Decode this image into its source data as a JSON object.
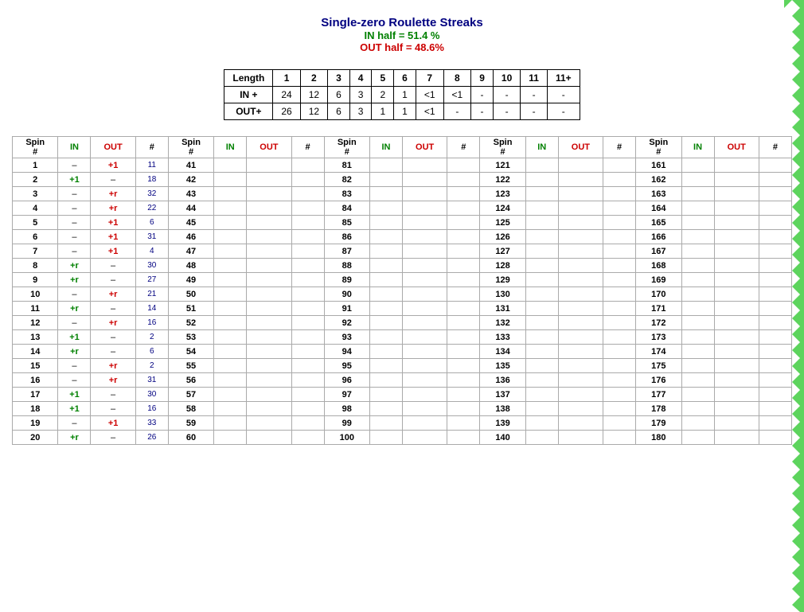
{
  "header": {
    "title": "Single-zero Roulette Streaks",
    "in_half": "IN half = 51.4 %",
    "out_half": "OUT half = 48.6%"
  },
  "summary": {
    "headers": [
      "Length",
      "1",
      "2",
      "3",
      "4",
      "5",
      "6",
      "7",
      "8",
      "9",
      "10",
      "11",
      "11+"
    ],
    "rows": [
      {
        "label": "IN +",
        "values": [
          "24",
          "12",
          "6",
          "3",
          "2",
          "1",
          "<1",
          "<1",
          "-",
          "-",
          "-",
          "-"
        ]
      },
      {
        "label": "OUT+",
        "values": [
          "26",
          "12",
          "6",
          "3",
          "1",
          "1",
          "<1",
          "-",
          "-",
          "-",
          "-",
          "-"
        ]
      }
    ]
  },
  "spin_table": {
    "column_headers": [
      "Spin #",
      "IN",
      "OUT",
      "#"
    ],
    "rows": [
      {
        "spin": "1",
        "in": "–",
        "out": "+1",
        "num": "11",
        "s2": "41",
        "i2": "",
        "o2": "",
        "n2": "",
        "s3": "81",
        "i3": "",
        "o3": "",
        "n3": "",
        "s4": "121",
        "i4": "",
        "o4": "",
        "n4": "",
        "s5": "161",
        "i5": "",
        "o5": "",
        "n5": ""
      },
      {
        "spin": "2",
        "in": "+1",
        "out": "–",
        "num": "18",
        "s2": "42",
        "i2": "",
        "o2": "",
        "n2": "",
        "s3": "82",
        "i3": "",
        "o3": "",
        "n3": "",
        "s4": "122",
        "i4": "",
        "o4": "",
        "n4": "",
        "s5": "162",
        "i5": "",
        "o5": "",
        "n5": ""
      },
      {
        "spin": "3",
        "in": "–",
        "out": "+r",
        "num": "32",
        "s2": "43",
        "i2": "",
        "o2": "",
        "n2": "",
        "s3": "83",
        "i3": "",
        "o3": "",
        "n3": "",
        "s4": "123",
        "i4": "",
        "o4": "",
        "n4": "",
        "s5": "163",
        "i5": "",
        "o5": "",
        "n5": ""
      },
      {
        "spin": "4",
        "in": "–",
        "out": "+r",
        "num": "22",
        "s2": "44",
        "i2": "",
        "o2": "",
        "n2": "",
        "s3": "84",
        "i3": "",
        "o3": "",
        "n3": "",
        "s4": "124",
        "i4": "",
        "o4": "",
        "n4": "",
        "s5": "164",
        "i5": "",
        "o5": "",
        "n5": ""
      },
      {
        "spin": "5",
        "in": "–",
        "out": "+1",
        "num": "6",
        "s2": "45",
        "i2": "",
        "o2": "",
        "n2": "",
        "s3": "85",
        "i3": "",
        "o3": "",
        "n3": "",
        "s4": "125",
        "i4": "",
        "o4": "",
        "n4": "",
        "s5": "165",
        "i5": "",
        "o5": "",
        "n5": ""
      },
      {
        "spin": "6",
        "in": "–",
        "out": "+1",
        "num": "31",
        "s2": "46",
        "i2": "",
        "o2": "",
        "n2": "",
        "s3": "86",
        "i3": "",
        "o3": "",
        "n3": "",
        "s4": "126",
        "i4": "",
        "o4": "",
        "n4": "",
        "s5": "166",
        "i5": "",
        "o5": "",
        "n5": ""
      },
      {
        "spin": "7",
        "in": "–",
        "out": "+1",
        "num": "4",
        "s2": "47",
        "i2": "",
        "o2": "",
        "n2": "",
        "s3": "87",
        "i3": "",
        "o3": "",
        "n3": "",
        "s4": "127",
        "i4": "",
        "o4": "",
        "n4": "",
        "s5": "167",
        "i5": "",
        "o5": "",
        "n5": ""
      },
      {
        "spin": "8",
        "in": "+r",
        "out": "–",
        "num": "30",
        "s2": "48",
        "i2": "",
        "o2": "",
        "n2": "",
        "s3": "88",
        "i3": "",
        "o3": "",
        "n3": "",
        "s4": "128",
        "i4": "",
        "o4": "",
        "n4": "",
        "s5": "168",
        "i5": "",
        "o5": "",
        "n5": ""
      },
      {
        "spin": "9",
        "in": "+r",
        "out": "–",
        "num": "27",
        "s2": "49",
        "i2": "",
        "o2": "",
        "n2": "",
        "s3": "89",
        "i3": "",
        "o3": "",
        "n3": "",
        "s4": "129",
        "i4": "",
        "o4": "",
        "n4": "",
        "s5": "169",
        "i5": "",
        "o5": "",
        "n5": ""
      },
      {
        "spin": "10",
        "in": "–",
        "out": "+r",
        "num": "21",
        "s2": "50",
        "i2": "",
        "o2": "",
        "n2": "",
        "s3": "90",
        "i3": "",
        "o3": "",
        "n3": "",
        "s4": "130",
        "i4": "",
        "o4": "",
        "n4": "",
        "s5": "170",
        "i5": "",
        "o5": "",
        "n5": ""
      },
      {
        "spin": "11",
        "in": "+r",
        "out": "–",
        "num": "14",
        "s2": "51",
        "i2": "",
        "o2": "",
        "n2": "",
        "s3": "91",
        "i3": "",
        "o3": "",
        "n3": "",
        "s4": "131",
        "i4": "",
        "o4": "",
        "n4": "",
        "s5": "171",
        "i5": "",
        "o5": "",
        "n5": ""
      },
      {
        "spin": "12",
        "in": "–",
        "out": "+r",
        "num": "16",
        "s2": "52",
        "i2": "",
        "o2": "",
        "n2": "",
        "s3": "92",
        "i3": "",
        "o3": "",
        "n3": "",
        "s4": "132",
        "i4": "",
        "o4": "",
        "n4": "",
        "s5": "172",
        "i5": "",
        "o5": "",
        "n5": ""
      },
      {
        "spin": "13",
        "in": "+1",
        "out": "–",
        "num": "2",
        "s2": "53",
        "i2": "",
        "o2": "",
        "n2": "",
        "s3": "93",
        "i3": "",
        "o3": "",
        "n3": "",
        "s4": "133",
        "i4": "",
        "o4": "",
        "n4": "",
        "s5": "173",
        "i5": "",
        "o5": "",
        "n5": ""
      },
      {
        "spin": "14",
        "in": "+r",
        "out": "–",
        "num": "6",
        "s2": "54",
        "i2": "",
        "o2": "",
        "n2": "",
        "s3": "94",
        "i3": "",
        "o3": "",
        "n3": "",
        "s4": "134",
        "i4": "",
        "o4": "",
        "n4": "",
        "s5": "174",
        "i5": "",
        "o5": "",
        "n5": ""
      },
      {
        "spin": "15",
        "in": "–",
        "out": "+r",
        "num": "2",
        "s2": "55",
        "i2": "",
        "o2": "",
        "n2": "",
        "s3": "95",
        "i3": "",
        "o3": "",
        "n3": "",
        "s4": "135",
        "i4": "",
        "o4": "",
        "n4": "",
        "s5": "175",
        "i5": "",
        "o5": "",
        "n5": ""
      },
      {
        "spin": "16",
        "in": "–",
        "out": "+r",
        "num": "31",
        "s2": "56",
        "i2": "",
        "o2": "",
        "n2": "",
        "s3": "96",
        "i3": "",
        "o3": "",
        "n3": "",
        "s4": "136",
        "i4": "",
        "o4": "",
        "n4": "",
        "s5": "176",
        "i5": "",
        "o5": "",
        "n5": ""
      },
      {
        "spin": "17",
        "in": "+1",
        "out": "–",
        "num": "30",
        "s2": "57",
        "i2": "",
        "o2": "",
        "n2": "",
        "s3": "97",
        "i3": "",
        "o3": "",
        "n3": "",
        "s4": "137",
        "i4": "",
        "o4": "",
        "n4": "",
        "s5": "177",
        "i5": "",
        "o5": "",
        "n5": ""
      },
      {
        "spin": "18",
        "in": "+1",
        "out": "–",
        "num": "16",
        "s2": "58",
        "i2": "",
        "o2": "",
        "n2": "",
        "s3": "98",
        "i3": "",
        "o3": "",
        "n3": "",
        "s4": "138",
        "i4": "",
        "o4": "",
        "n4": "",
        "s5": "178",
        "i5": "",
        "o5": "",
        "n5": ""
      },
      {
        "spin": "19",
        "in": "–",
        "out": "+1",
        "num": "33",
        "s2": "59",
        "i2": "",
        "o2": "",
        "n2": "",
        "s3": "99",
        "i3": "",
        "o3": "",
        "n3": "",
        "s4": "139",
        "i4": "",
        "o4": "",
        "n4": "",
        "s5": "179",
        "i5": "",
        "o5": "",
        "n5": ""
      },
      {
        "spin": "20",
        "in": "+r",
        "out": "–",
        "num": "26",
        "s2": "60",
        "i2": "",
        "o2": "",
        "n2": "",
        "s3": "100",
        "i3": "",
        "o3": "",
        "n3": "",
        "s4": "140",
        "i4": "",
        "o4": "",
        "n4": "",
        "s5": "180",
        "i5": "",
        "o5": "",
        "n5": ""
      }
    ]
  }
}
